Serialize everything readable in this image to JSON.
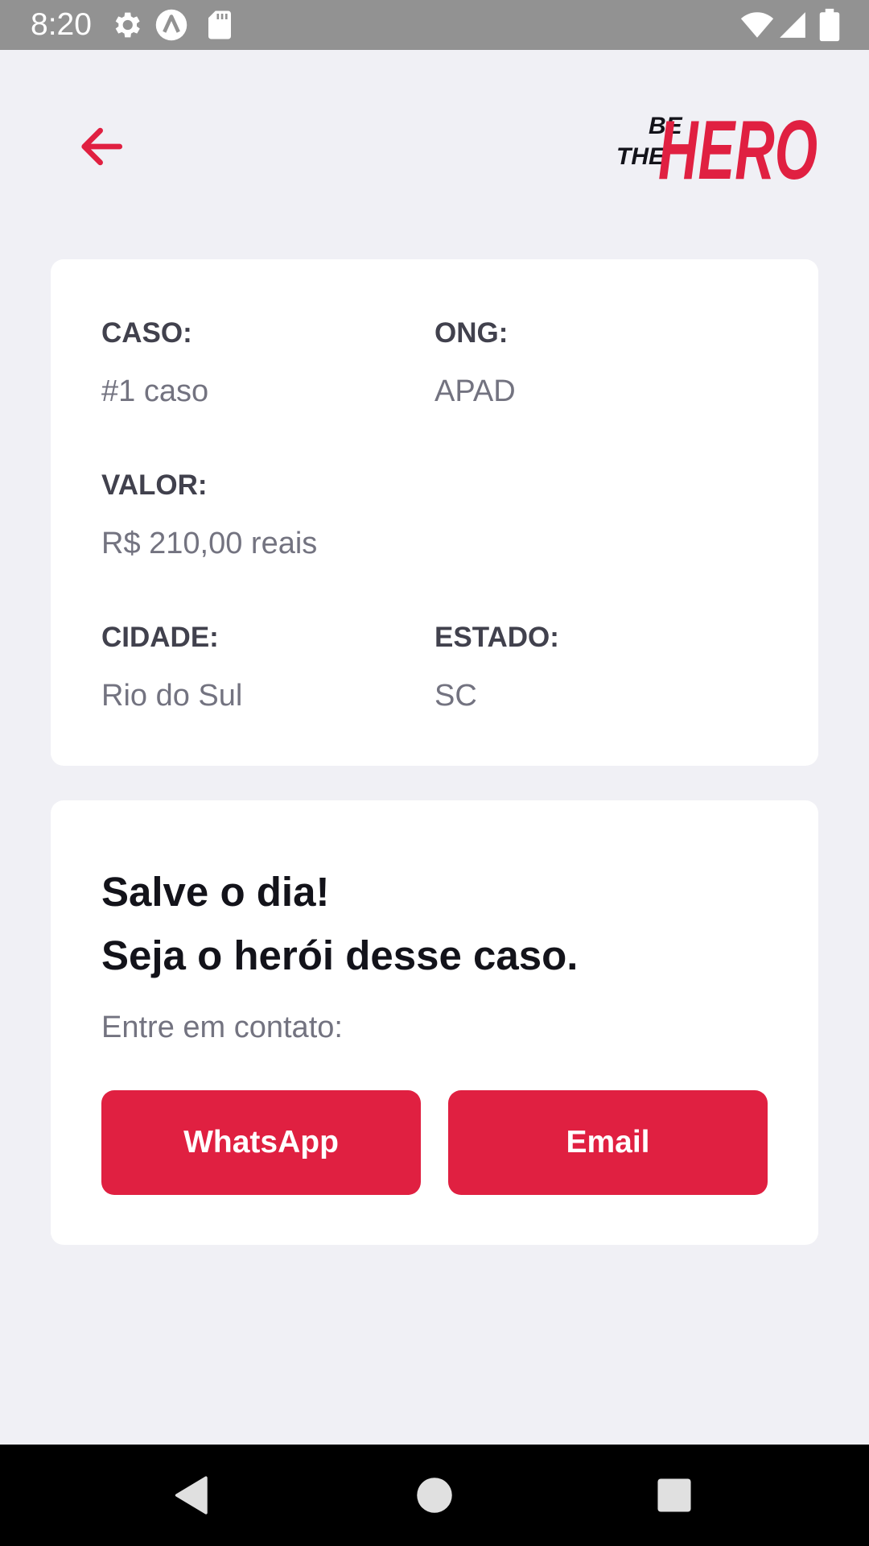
{
  "status_bar": {
    "time": "8:20",
    "left_icons": [
      "gear-icon",
      "app-a-icon",
      "sd-card-icon"
    ],
    "right_icons": [
      "wifi-icon",
      "signal-icon",
      "battery-icon"
    ]
  },
  "header": {
    "back_icon": "arrow-left-icon",
    "logo": {
      "line1": "BE",
      "line2": "THE",
      "line3": "HERO"
    }
  },
  "incident": {
    "case_label": "CASO:",
    "case_value": "#1 caso",
    "ong_label": "ONG:",
    "ong_value": "APAD",
    "value_label": "VALOR:",
    "value_value": "R$ 210,00 reais",
    "city_label": "CIDADE:",
    "city_value": "Rio do Sul",
    "state_label": "ESTADO:",
    "state_value": "SC"
  },
  "contact": {
    "title_line1": "Salve o dia!",
    "title_line2": "Seja o herói desse caso.",
    "prompt": "Entre em contato:",
    "whatsapp_label": "WhatsApp",
    "email_label": "Email"
  },
  "nav_bar": {
    "icons": [
      "back-triangle-icon",
      "home-circle-icon",
      "recents-square-icon"
    ]
  },
  "colors": {
    "accent": "#e02041",
    "background": "#f0f0f5",
    "card": "#ffffff",
    "label_text": "#41414d",
    "value_text": "#737380",
    "title_text": "#13131a",
    "status_bar": "#929292",
    "nav_bar": "#000000"
  }
}
